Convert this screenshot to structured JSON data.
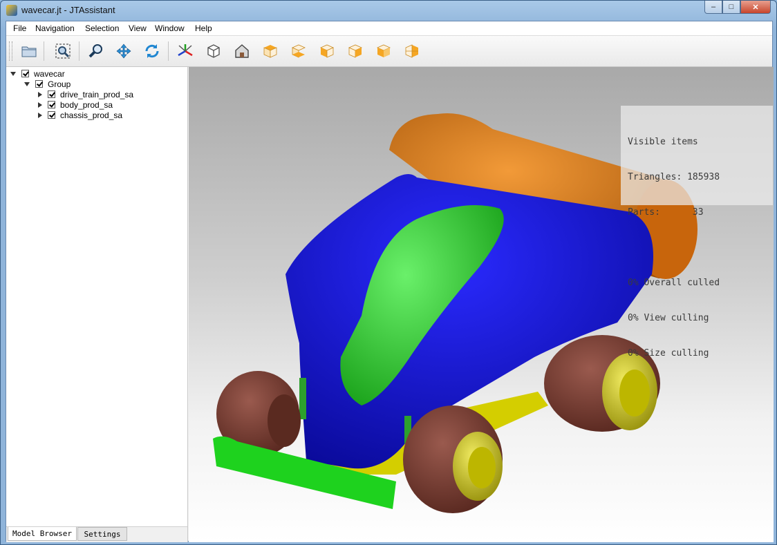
{
  "window": {
    "title": "wavecar.jt - JTAssistant",
    "controls": {
      "minimize": "–",
      "maximize": "□",
      "close": "✕"
    }
  },
  "menu": {
    "items": [
      "File",
      "Navigation",
      "Selection",
      "View",
      "Window",
      "Help"
    ]
  },
  "toolbar": {
    "buttons": [
      {
        "icon": "open-file-icon"
      },
      {
        "icon": "zoom-fit-icon"
      },
      {
        "icon": "zoom-icon"
      },
      {
        "icon": "pan-icon"
      },
      {
        "icon": "rotate-icon"
      },
      {
        "icon": "axis-triad-icon"
      },
      {
        "icon": "view-cube-wireframe-icon"
      },
      {
        "icon": "home-view-icon"
      },
      {
        "icon": "view-top-icon"
      },
      {
        "icon": "view-bottom-icon"
      },
      {
        "icon": "view-left-icon"
      },
      {
        "icon": "view-right-icon"
      },
      {
        "icon": "view-front-icon"
      },
      {
        "icon": "view-back-icon"
      }
    ]
  },
  "model_browser": {
    "tree": [
      {
        "label": "wavecar",
        "checked": true,
        "expanded": true
      },
      {
        "label": "Group",
        "checked": true,
        "expanded": true
      },
      {
        "label": "drive_train_prod_sa",
        "checked": true,
        "expanded": false
      },
      {
        "label": "body_prod_sa",
        "checked": true,
        "expanded": false
      },
      {
        "label": "chassis_prod_sa",
        "checked": true,
        "expanded": false
      }
    ],
    "tabs": [
      "Model Browser",
      "Settings"
    ],
    "active_tab": "Model Browser"
  },
  "stats_overlay": {
    "heading": "Visible items",
    "triangles": "Triangles: 185938",
    "parts": "Parts:      33",
    "overall_culled": "0% Overall culled",
    "view_culling": "0% View culling",
    "size_culling": "0% Size culling"
  },
  "colors": {
    "body": "#1010c8",
    "canopy": "#22c822",
    "tank": "#d27010",
    "tire": "#7a3a30",
    "hub": "#d8d010",
    "chassis": "#e6e000",
    "wing": "#1ed21e"
  }
}
